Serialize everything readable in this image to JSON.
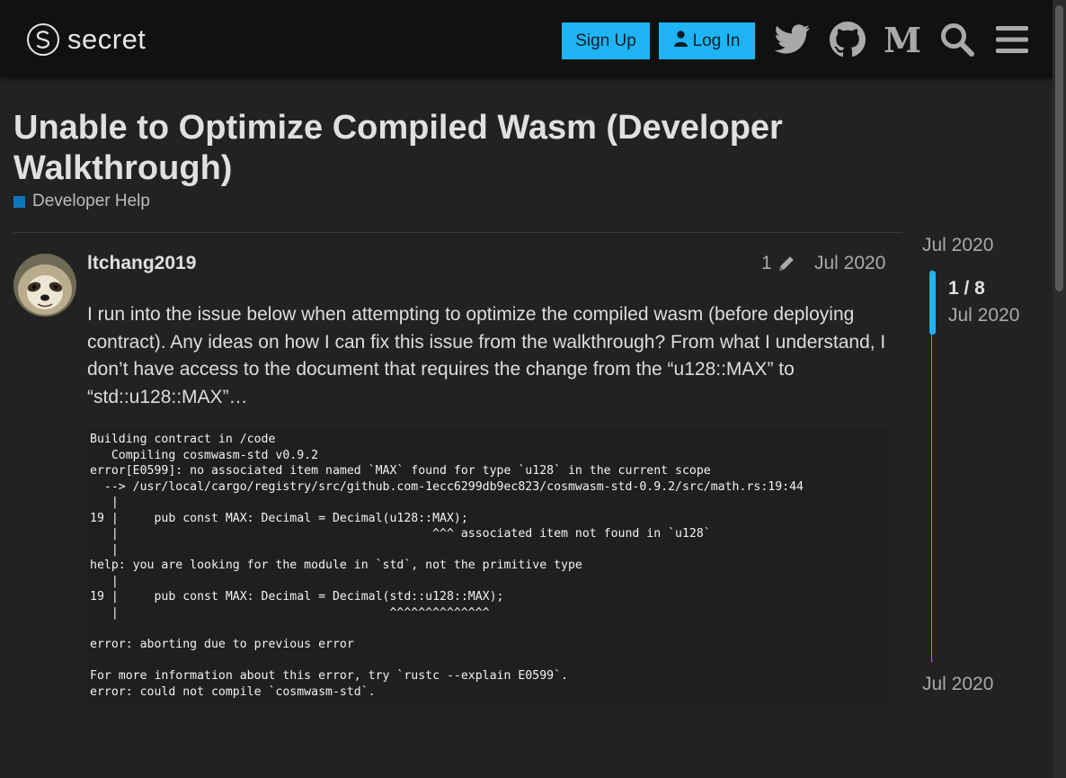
{
  "header": {
    "logo_text": "secret",
    "signup_label": "Sign Up",
    "login_label": "Log In",
    "icons": [
      "twitter-icon",
      "github-icon",
      "medium-icon",
      "search-icon",
      "hamburger-menu-icon"
    ]
  },
  "topic": {
    "title": "Unable to Optimize Compiled Wasm (Developer Walkthrough)",
    "category": "Developer Help",
    "category_color": "#0e76bd"
  },
  "post": {
    "username": "ltchang2019",
    "edit_count": "1",
    "date": "Jul 2020",
    "body": "I run into the issue below when attempting to optimize the compiled wasm (before deploying contract). Any ideas on how I can fix this issue from the walkthrough? From what I understand, I don’t have access to the document that requires the change from the “u128::MAX” to “std::u128::MAX”…",
    "code": "Building contract in /code\n   Compiling cosmwasm-std v0.9.2\nerror[E0599]: no associated item named `MAX` found for type `u128` in the current scope\n  --> /usr/local/cargo/registry/src/github.com-1ecc6299db9ec823/cosmwasm-std-0.9.2/src/math.rs:19:44\n   |\n19 |     pub const MAX: Decimal = Decimal(u128::MAX);\n   |                                            ^^^ associated item not found in `u128`\n   |\nhelp: you are looking for the module in `std`, not the primitive type\n   |\n19 |     pub const MAX: Decimal = Decimal(std::u128::MAX);\n   |                                      ^^^^^^^^^^^^^^\n\nerror: aborting due to previous error\n\nFor more information about this error, try `rustc --explain E0599`.\nerror: could not compile `cosmwasm-std`."
  },
  "timeline": {
    "start_date": "Jul 2020",
    "position": "1 / 8",
    "current_date": "Jul 2020",
    "end_date": "Jul 2020"
  },
  "colors": {
    "accent": "#1eb4f5",
    "background": "#222222",
    "header_bg": "#111111"
  }
}
